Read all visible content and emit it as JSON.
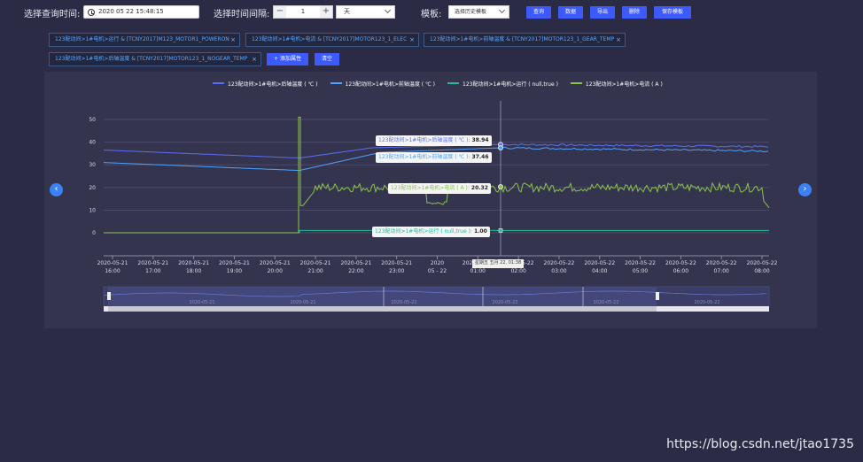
{
  "toolbar": {
    "start_time_label": "选择查询时间:",
    "start_time_value": "2020 05 22 15:48:15",
    "interval_label": "选择时间间隔:",
    "interval_minus": "−",
    "interval_value": "1",
    "interval_plus": "+",
    "interval_unit": "天",
    "template_label": "模板:",
    "template_value": "选择历史模板",
    "buttons": [
      "查询",
      "数据",
      "导出",
      "删除",
      "保存模板"
    ]
  },
  "tags": [
    "123配动间>1#电机>运行 & [TCNY2017]M123_MOTOR1_POWERON",
    "123配动间>1#电机>电流 & [TCNY2017]MOTOR123_1_ELEC",
    "123配动间>1#电机>前轴温度 & [TCNY2017]MOTOR123_1_GEAR_TEMP",
    "123配动间>1#电机>后轴温度 & [TCNY2017]MOTOR123_1_NOGEAR_TEMP"
  ],
  "tag_actions": {
    "add": "+ 添加属性",
    "clear": "清空"
  },
  "chart": {
    "legend": [
      {
        "name": "123配动间>1#电机>后轴温度 ( ℃ )",
        "color": "#5b6ef5"
      },
      {
        "name": "123配动间>1#电机>前轴温度 ( ℃ )",
        "color": "#4da3ff"
      },
      {
        "name": "123配动间>1#电机>运行 ( null,true )",
        "color": "#1abc9c"
      },
      {
        "name": "123配动间>1#电机>电流 ( A )",
        "color": "#8bc34a"
      }
    ],
    "tooltips": [
      {
        "label": "123配动间>1#电机>后轴温度 ( ℃ ):",
        "value": "38.94",
        "color": "#5b6ef5"
      },
      {
        "label": "123配动间>1#电机>前轴温度 ( ℃ ):",
        "value": "37.46",
        "color": "#4da3ff"
      },
      {
        "label": "123配动间>1#电机>电流 ( A ):",
        "value": "20.32",
        "color": "#8bc34a"
      },
      {
        "label": "123配动间>1#电机>运行 ( null,true ):",
        "value": "1.00",
        "color": "#1abc9c"
      }
    ],
    "x_tooltip": "星期五 五月 22, 01:38",
    "y_ticks": [
      "50",
      "40",
      "30",
      "20",
      "10",
      "0"
    ],
    "x_ticks": [
      [
        "2020-05-21",
        "16:00"
      ],
      [
        "2020-05-21",
        "17:00"
      ],
      [
        "2020-05-21",
        "18:00"
      ],
      [
        "2020-05-21",
        "19:00"
      ],
      [
        "2020-05-21",
        "20:00"
      ],
      [
        "2020-05-21",
        "21:00"
      ],
      [
        "2020-05-21",
        "22:00"
      ],
      [
        "2020-05-21",
        "23:00"
      ],
      [
        "2020",
        "05 - 22"
      ],
      [
        "2020-05-22",
        "01:00"
      ],
      [
        "2020-05-22",
        "02:00"
      ],
      [
        "2020-05-22",
        "03:00"
      ],
      [
        "2020-05-22",
        "04:00"
      ],
      [
        "2020-05-22",
        "05:00"
      ],
      [
        "2020-05-22",
        "06:00"
      ],
      [
        "2020-05-22",
        "07:00"
      ],
      [
        "2020-05-22",
        "08:00"
      ]
    ],
    "navigator_labels": [
      "2020-05-21",
      "2020-05-21",
      "2020-05-22",
      "2020-05-22",
      "2020-05-22",
      "2020-05-22"
    ]
  },
  "watermark": "https://blog.csdn.net/jtao1735"
}
